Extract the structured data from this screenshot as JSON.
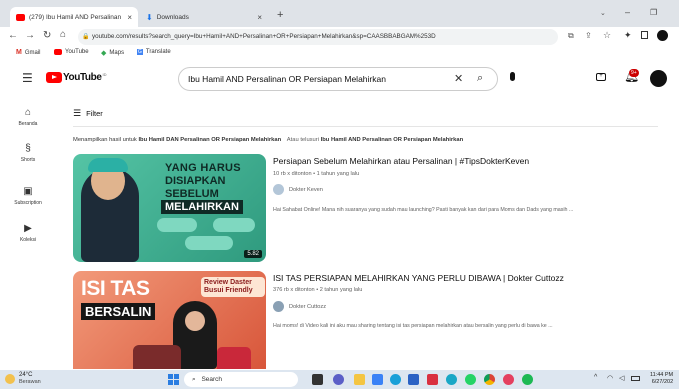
{
  "browser": {
    "tabs": [
      {
        "label": "(279) Ibu Hamil AND Persalinan",
        "close": "×"
      },
      {
        "label": "Downloads",
        "close": "×"
      }
    ],
    "new_tab": "+",
    "url": "youtube.com/results?search_query=Ibu+Hamil+AND+Persalinan+OR+Persiapan+Melahirkan&sp=CAASBBABGAM%253D",
    "bookmarks": [
      "Gmail",
      "YouTube",
      "Maps",
      "Translate"
    ]
  },
  "youtube": {
    "logo_text": "YouTube",
    "logo_region": "ID",
    "search_query": "Ibu Hamil AND Persalinan OR Persiapan Melahirkan",
    "notif_count": "9+",
    "filter_label": "Filter",
    "sidebar": [
      {
        "label": "Beranda",
        "icon": "home-icon"
      },
      {
        "label": "Shorts",
        "icon": "shorts-icon"
      },
      {
        "label": "Subscription",
        "icon": "subscriptions-icon"
      },
      {
        "label": "Koleksi",
        "icon": "library-icon"
      }
    ],
    "showing_prefix": "Menampilkan hasil untuk",
    "showing_query": "Ibu Hamil DAN Persalinan OR Persiapan Melahirkan",
    "alt_prefix": "Atau telusuri",
    "alt_query": "Ibu Hamil AND Persalinan OR Persiapan Melahirkan",
    "results": [
      {
        "title": "Persiapan Sebelum Melahirkan atau Persalinan | #TipsDokterKeven",
        "meta": "10 rb x ditonton • 1 tahun yang lalu",
        "channel": "Dokter Keven",
        "desc": "Hai Sahabat Online! Mana nih suaranya yang sudah mau launching? Pasti banyak kan dari para Moms dan Dads yang masih ...",
        "duration": "5.82",
        "thumb_line1": "YANG HARUS",
        "thumb_line2": "DISIAPKAN",
        "thumb_line3": "SEBELUM",
        "thumb_line4": "MELAHIRKAN"
      },
      {
        "title": "ISI TAS PERSIAPAN MELAHIRKAN YANG PERLU DIBAWA | Dokter Cuttozz",
        "meta": "376 rb x ditonton • 2 tahun yang lalu",
        "channel": "Dokter Cuttozz",
        "desc": "Hai moms! di Video kali ini aku mau sharing tentang isi tas persiapan melahirkan atau bersalin yang perlu di bawa ke ...",
        "thumb_line1": "ISI TAS",
        "thumb_line2": "BERSALIN",
        "thumb_badge": "Review Daster Busui Friendly"
      }
    ]
  },
  "taskbar": {
    "weather_temp": "24°C",
    "weather_text": "Berawan",
    "search_label": "Search",
    "time": "11:44 PM",
    "date": "6/27/202"
  },
  "colors": {
    "yt_red": "#ff0000",
    "thumb1_bg": "#3fa98a",
    "thumb2_bg": "#e06a4b"
  }
}
